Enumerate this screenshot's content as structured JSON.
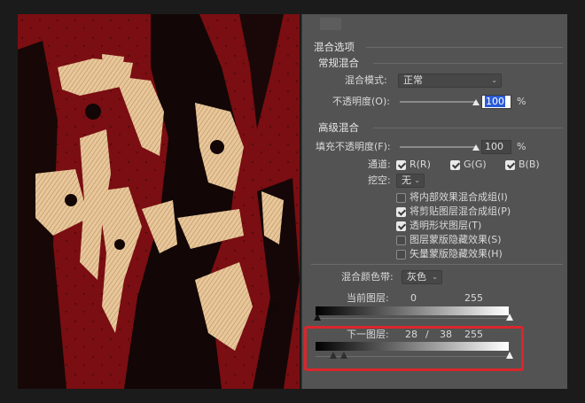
{
  "panel": {
    "title": "混合选项",
    "general": {
      "heading": "常规混合",
      "blend_mode_label": "混合模式:",
      "blend_mode_value": "正常",
      "opacity_label": "不透明度(O):",
      "opacity_value": "100",
      "opacity_unit": "%",
      "opacity_level": 1.0
    },
    "advanced": {
      "heading": "高级混合",
      "fill_label": "填充不透明度(F):",
      "fill_value": "100",
      "fill_unit": "%",
      "fill_level": 1.0,
      "channels_label": "通道:",
      "channels": [
        {
          "label": "R(R)",
          "checked": true
        },
        {
          "label": "G(G)",
          "checked": true
        },
        {
          "label": "B(B)",
          "checked": true
        }
      ],
      "knockout_label": "挖空:",
      "knockout_value": "无",
      "options": [
        {
          "label": "将内部效果混合成组(I)",
          "checked": false
        },
        {
          "label": "将剪贴图层混合成组(P)",
          "checked": true
        },
        {
          "label": "透明形状图层(T)",
          "checked": true
        },
        {
          "label": "图层蒙版隐藏效果(S)",
          "checked": false
        },
        {
          "label": "矢量蒙版隐藏效果(H)",
          "checked": false
        }
      ]
    },
    "blend_if": {
      "label": "混合颜色带:",
      "value": "灰色",
      "this_layer_label": "当前图层:",
      "this_layer_black": "0",
      "this_layer_white": "255",
      "underlying_label": "下一图层:",
      "underlying_low": "28",
      "underlying_sep": "/",
      "underlying_high": "38",
      "underlying_white": "255"
    }
  },
  "artwork": {
    "background_color": "#7a0e12",
    "ink_color": "#120606",
    "texture_color": "#e8c79a"
  },
  "highlight_color": "#d9262c"
}
